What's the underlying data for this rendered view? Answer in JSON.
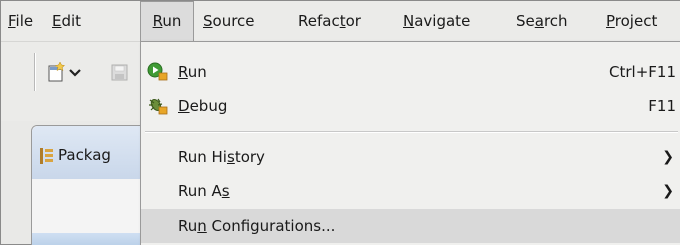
{
  "menubar": {
    "items": [
      {
        "pre": "",
        "mn": "F",
        "post": "ile"
      },
      {
        "pre": "",
        "mn": "E",
        "post": "dit"
      },
      {
        "pre": "",
        "mn": "R",
        "post": "un"
      },
      {
        "pre": "",
        "mn": "S",
        "post": "ource"
      },
      {
        "pre": "Refac",
        "mn": "t",
        "post": "or"
      },
      {
        "pre": "",
        "mn": "N",
        "post": "avigate"
      },
      {
        "pre": "Se",
        "mn": "a",
        "post": "rch"
      },
      {
        "pre": "",
        "mn": "P",
        "post": "roject"
      }
    ]
  },
  "view": {
    "tab_label": "Packag"
  },
  "run_menu": {
    "items": [
      {
        "pre": "",
        "mn": "R",
        "post": "un",
        "accel": "Ctrl+F11",
        "icon": "run-icon"
      },
      {
        "pre": "",
        "mn": "D",
        "post": "ebug",
        "accel": "F11",
        "icon": "debug-icon"
      },
      {
        "pre": "Run Hi",
        "mn": "s",
        "post": "tory",
        "submenu": true
      },
      {
        "pre": "Run A",
        "mn": "s",
        "post": "",
        "submenu": true
      },
      {
        "pre": "Ru",
        "mn": "n",
        "post": " Configurations...",
        "highlighted": true
      }
    ]
  },
  "colors": {
    "menubar_bg": "#ebebe9",
    "menu_bg": "#f0f0ee",
    "highlight": "#d9d9d9",
    "view_tab": "#c9d7ea"
  }
}
